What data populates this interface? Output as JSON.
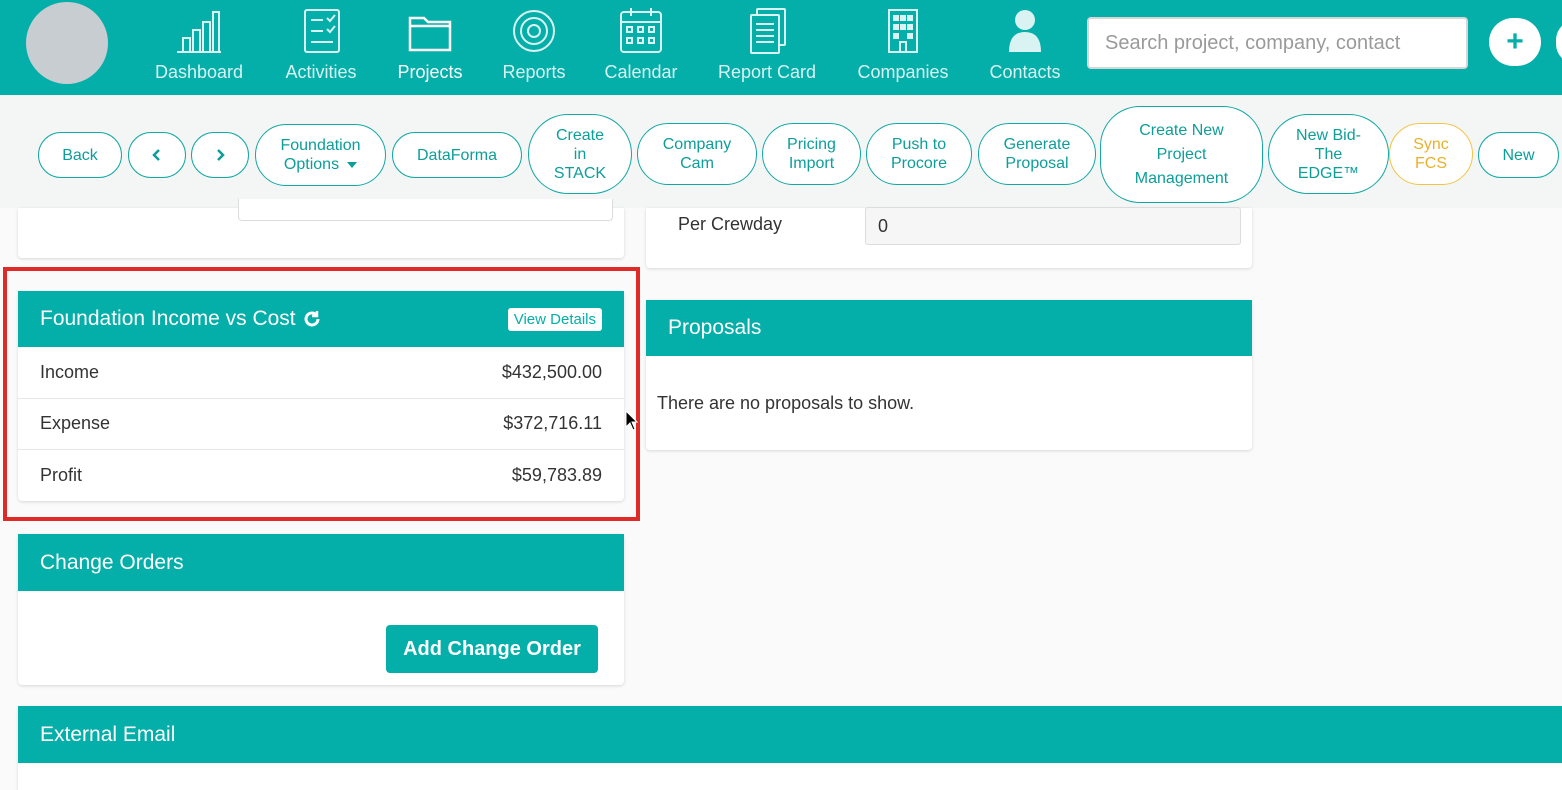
{
  "nav": {
    "items": [
      {
        "label": "Dashboard",
        "icon": "bar-chart-icon",
        "active": false
      },
      {
        "label": "Activities",
        "icon": "checklist-icon",
        "active": false
      },
      {
        "label": "Projects",
        "icon": "folder-icon",
        "active": true
      },
      {
        "label": "Reports",
        "icon": "target-icon",
        "active": false
      },
      {
        "label": "Calendar",
        "icon": "calendar-icon",
        "active": false
      },
      {
        "label": "Report Card",
        "icon": "documents-icon",
        "active": false
      },
      {
        "label": "Companies",
        "icon": "building-icon",
        "active": false
      },
      {
        "label": "Contacts",
        "icon": "person-icon",
        "active": false
      }
    ],
    "search_placeholder": "Search project, company, contact",
    "add_label": "+"
  },
  "actions": {
    "back": "Back",
    "foundation_options": "Foundation Options",
    "dataforma": "DataForma",
    "create_stack": "Create in STACK",
    "company_cam": "Company Cam",
    "pricing_import": "Pricing Import",
    "push_procore": "Push to Procore",
    "generate_proposal": "Generate Proposal",
    "create_pm": "Create New Project Management",
    "new_bid": "New Bid- The EDGE™",
    "sync_fcs": "Sync FCS",
    "new": "New"
  },
  "crewday": {
    "label": "Per Crewday",
    "value": "0"
  },
  "income_card": {
    "title": "Foundation Income vs Cost",
    "view_details": "View Details",
    "rows": [
      {
        "label": "Income",
        "value": "$432,500.00"
      },
      {
        "label": "Expense",
        "value": "$372,716.11"
      },
      {
        "label": "Profit",
        "value": "$59,783.89"
      }
    ]
  },
  "proposals": {
    "title": "Proposals",
    "empty": "There are no proposals to show."
  },
  "change_orders": {
    "title": "Change Orders",
    "add_button": "Add Change Order"
  },
  "external_email": {
    "title": "External Email"
  },
  "colors": {
    "brand": "#04aea9",
    "highlight": "#e02a27",
    "sync": "#f3c441"
  }
}
